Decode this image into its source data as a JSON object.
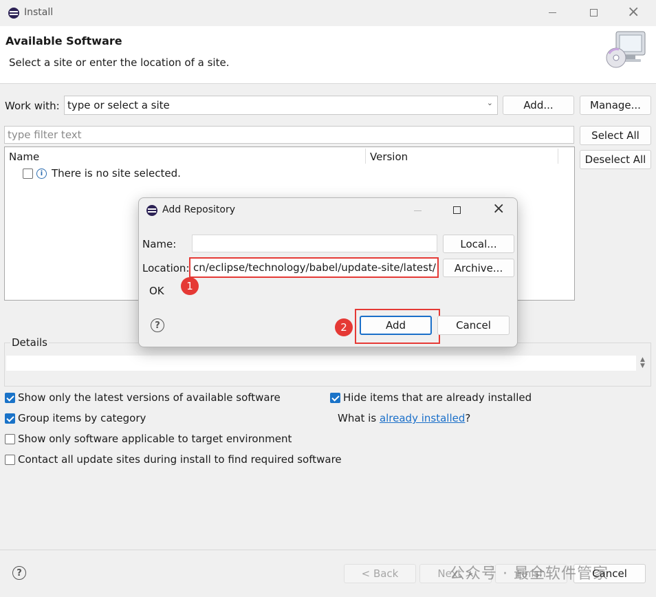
{
  "window": {
    "title": "Install"
  },
  "header": {
    "title": "Available Software",
    "subtitle": "Select a site or enter the location of a site."
  },
  "work_with": {
    "label": "Work with:",
    "value": "type or select a site",
    "add_label": "Add...",
    "manage_label": "Manage..."
  },
  "filter": {
    "placeholder": "type filter text"
  },
  "selection": {
    "select_all": "Select All",
    "deselect_all": "Deselect All"
  },
  "table": {
    "col_name": "Name",
    "col_version": "Version",
    "rows": [
      {
        "text": "There is no site selected."
      }
    ]
  },
  "details": {
    "label": "Details"
  },
  "options": {
    "latest_versions": {
      "label": "Show only the latest versions of available software",
      "checked": true
    },
    "group_by_category": {
      "label": "Group items by category",
      "checked": true
    },
    "target_env": {
      "label": "Show only software applicable to target environment",
      "checked": false
    },
    "contact_sites": {
      "label": "Contact all update sites during install to find required software",
      "checked": false
    },
    "hide_installed": {
      "label": "Hide items that are already installed",
      "checked": true
    },
    "what_is_prefix": "What is ",
    "what_is_link": "already installed",
    "what_is_suffix": "?"
  },
  "footer": {
    "back": "< Back",
    "next": "Next >",
    "finish": "Finish",
    "cancel": "Cancel",
    "watermark": "公众号 · 最全软件管家"
  },
  "dialog": {
    "title": "Add Repository",
    "name_label": "Name:",
    "name_value": "",
    "local_label": "Local...",
    "location_label": "Location:",
    "location_value": "cn/eclipse/technology/babel/update-site/latest/",
    "archive_label": "Archive...",
    "status": "OK",
    "add_label": "Add",
    "cancel_label": "Cancel"
  },
  "annotations": {
    "badge1": "1",
    "badge2": "2",
    "accent": "#e53935"
  }
}
